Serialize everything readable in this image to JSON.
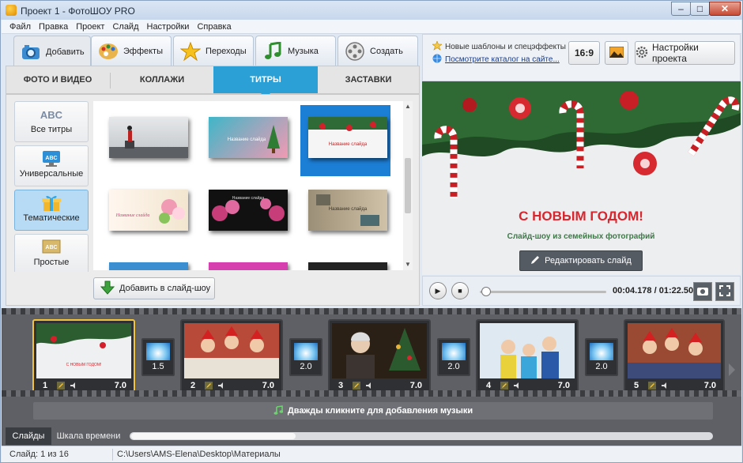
{
  "window": {
    "title": "Проект 1 - ФотоШОУ PRO"
  },
  "menu": {
    "items": [
      "Файл",
      "Правка",
      "Проект",
      "Слайд",
      "Настройки",
      "Справка"
    ]
  },
  "main_tabs": [
    {
      "label": "Добавить",
      "icon": "camera-icon"
    },
    {
      "label": "Эффекты",
      "icon": "palette-icon"
    },
    {
      "label": "Переходы",
      "icon": "star-icon"
    },
    {
      "label": "Музыка",
      "icon": "music-note-icon"
    },
    {
      "label": "Создать",
      "icon": "film-reel-icon"
    }
  ],
  "sub_tabs": [
    "ФОТО И ВИДЕО",
    "КОЛЛАЖИ",
    "ТИТРЫ",
    "ЗАСТАВКИ"
  ],
  "active_sub_tab": "ТИТРЫ",
  "categories": [
    {
      "label": "Все титры",
      "icon_text": "ABC"
    },
    {
      "label": "Универсальные",
      "icon_text": "ABC"
    },
    {
      "label": "Тематические",
      "icon_text": ""
    },
    {
      "label": "Простые",
      "icon_text": "ABC"
    }
  ],
  "thumbs": [
    {
      "caption": ""
    },
    {
      "caption": "Название слайда"
    },
    {
      "caption": "Название слайда"
    },
    {
      "caption": "Название слайда"
    },
    {
      "caption": "Название слайда"
    },
    {
      "caption": "Название слайда"
    }
  ],
  "add_to_show_label": "Добавить в слайд-шоу",
  "news": {
    "line1": "Новые шаблоны и спецэффекты",
    "line2": "Посмотрите каталог на сайте..."
  },
  "aspect_ratio": "16:9",
  "project_settings_label": "Настройки проекта",
  "preview": {
    "headline": "С НОВЫМ ГОДОМ!",
    "subline": "Слайд-шоу из семейных фотографий",
    "edit_button": "Редактировать слайд"
  },
  "player": {
    "time": "00:04.178 / 01:22.500",
    "progress": 0.05
  },
  "slides": [
    {
      "num": "1",
      "dur": "7.0"
    },
    {
      "num": "2",
      "dur": "7.0"
    },
    {
      "num": "3",
      "dur": "7.0"
    },
    {
      "num": "4",
      "dur": "7.0"
    },
    {
      "num": "5",
      "dur": "7.0"
    }
  ],
  "transitions": [
    "1.5",
    "2.0",
    "2.0",
    "2.0"
  ],
  "music_hint": "Дважды кликните для добавления музыки",
  "bottom_tabs": [
    "Слайды",
    "Шкала времени"
  ],
  "status": {
    "slide_counter": "Слайд: 1 из 16",
    "path": "C:\\Users\\AMS-Elena\\Desktop\\Материалы"
  },
  "colors": {
    "accent": "#2ba0d6",
    "selection": "#1c7fd6",
    "active_slide_border": "#f2c23a",
    "headline_red": "#d8262e"
  }
}
